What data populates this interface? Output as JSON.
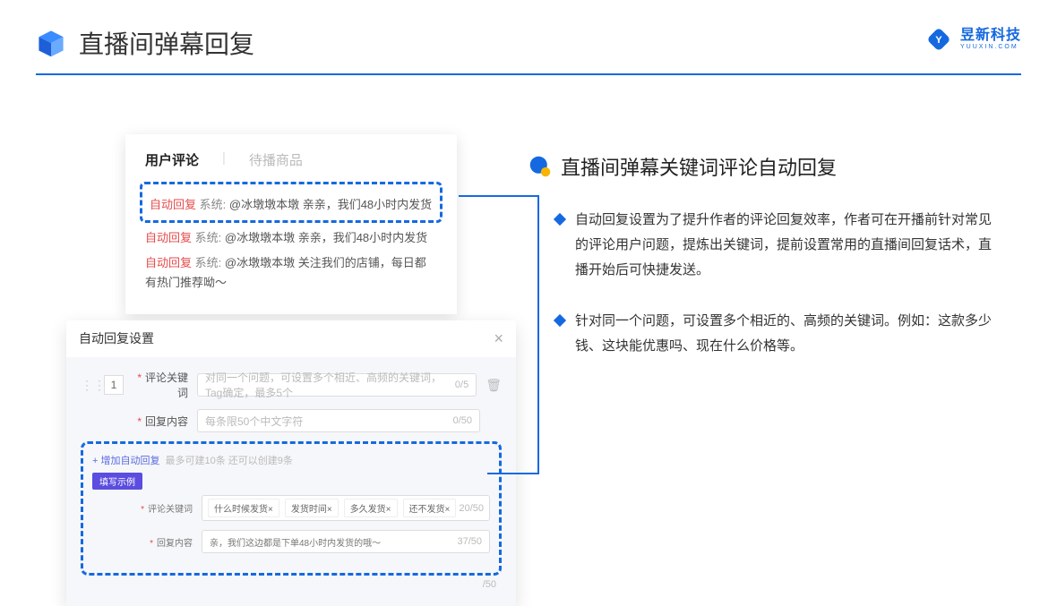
{
  "header": {
    "title": "直播间弹幕回复"
  },
  "logo": {
    "cn": "昱新科技",
    "en": "YUUXIN.COM"
  },
  "panel1": {
    "tab_active": "用户评论",
    "tab_inactive": "待播商品",
    "auto_label": "自动回复",
    "sys_label": "系统:",
    "c1": "@冰墩墩本墩 亲亲，我们48小时内发货",
    "c2": "@冰墩墩本墩 亲亲，我们48小时内发货",
    "c3": "@冰墩墩本墩 关注我们的店铺，每日都有热门推荐呦～"
  },
  "panel2": {
    "title": "自动回复设置",
    "num": "1",
    "label_kw": "评论关键词",
    "ph_kw": "对同一个问题，可设置多个相近、高频的关键词，Tag确定，最多5个",
    "count_kw": "0/5",
    "label_reply": "回复内容",
    "ph_reply": "每条限50个中文字符",
    "count_reply": "0/50",
    "add": "+ 增加自动回复",
    "add_hint": "最多可建10条 还可以创建9条",
    "pill": "填写示例",
    "tags": [
      "什么时候发货×",
      "发货时间×",
      "多久发货×",
      "还不发货×"
    ],
    "tag_count": "20/50",
    "ex_reply": "亲，我们这边都是下单48小时内发货的哦～",
    "ex_count": "37/50",
    "trail_count": "/50"
  },
  "right": {
    "subtitle": "直播间弹幕关键词评论自动回复",
    "b1": "自动回复设置为了提升作者的评论回复效率，作者可在开播前针对常见的评论用户问题，提炼出关键词，提前设置常用的直播间回复话术，直播开始后可快捷发送。",
    "b2": "针对同一个问题，可设置多个相近的、高频的关键词。例如：这款多少钱、这块能优惠吗、现在什么价格等。"
  }
}
